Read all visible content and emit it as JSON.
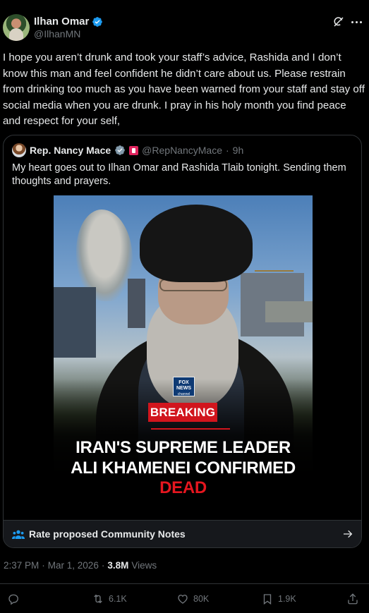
{
  "author": {
    "name": "Ilhan Omar",
    "handle": "@IlhanMN"
  },
  "tweet": {
    "text": "I hope you aren’t drunk and took your staff’s advice, Rashida and I don’t know this man and feel confident he didn’t care about us. Please restrain from drinking too much as you have been warned from your staff and stay off social media when you are drunk. I pray in his holy month you find peace and respect for your self,"
  },
  "quoted": {
    "name": "Rep. Nancy Mace",
    "handle": "@RepNancyMace",
    "separator": "·",
    "time": "9h",
    "text": "My heart goes out to Ilhan Omar and Rashida Tlaib tonight. Sending them thoughts and prayers.",
    "media": {
      "logo_line1": "FOX",
      "logo_line2": "NEWS",
      "logo_line3": "channel",
      "badge": "BREAKING",
      "headline_line1": "IRAN'S SUPREME LEADER",
      "headline_line2_white": "ALI KHAMENEI CONFIRMED ",
      "headline_line2_red": "DEAD"
    },
    "community_notes": "Rate proposed Community Notes"
  },
  "meta": {
    "time": "2:37 PM",
    "sep": "·",
    "date": "Mar 1, 2026",
    "sep2": "·",
    "views_count": "3.8M",
    "views_label": "Views"
  },
  "actions": {
    "replies": "",
    "reposts": "6.1K",
    "likes": "80K",
    "bookmarks": "1.9K"
  },
  "colors": {
    "background": "#000000",
    "text": "#e7e9ea",
    "secondary": "#71767b",
    "verified": "#1d9bf0",
    "breaking_red": "#d1151d",
    "border": "#2f3336"
  },
  "icons": [
    "verified-icon",
    "grok-icon",
    "more-icon",
    "community-notes-icon",
    "arrow-right-icon",
    "reply-icon",
    "repost-icon",
    "like-icon",
    "bookmark-icon",
    "share-icon"
  ]
}
